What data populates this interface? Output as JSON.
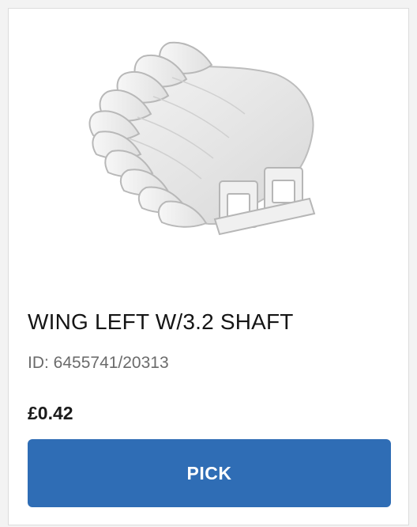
{
  "product": {
    "name": "WING LEFT W/3.2 SHAFT",
    "id_text": "ID: 6455741/20313",
    "price": "£0.42",
    "image_icon": "wing-brick-icon"
  },
  "actions": {
    "pick_label": "PICK"
  },
  "colors": {
    "button": "#2f6db5",
    "card_background": "#ffffff",
    "border": "#dcdcdc"
  }
}
